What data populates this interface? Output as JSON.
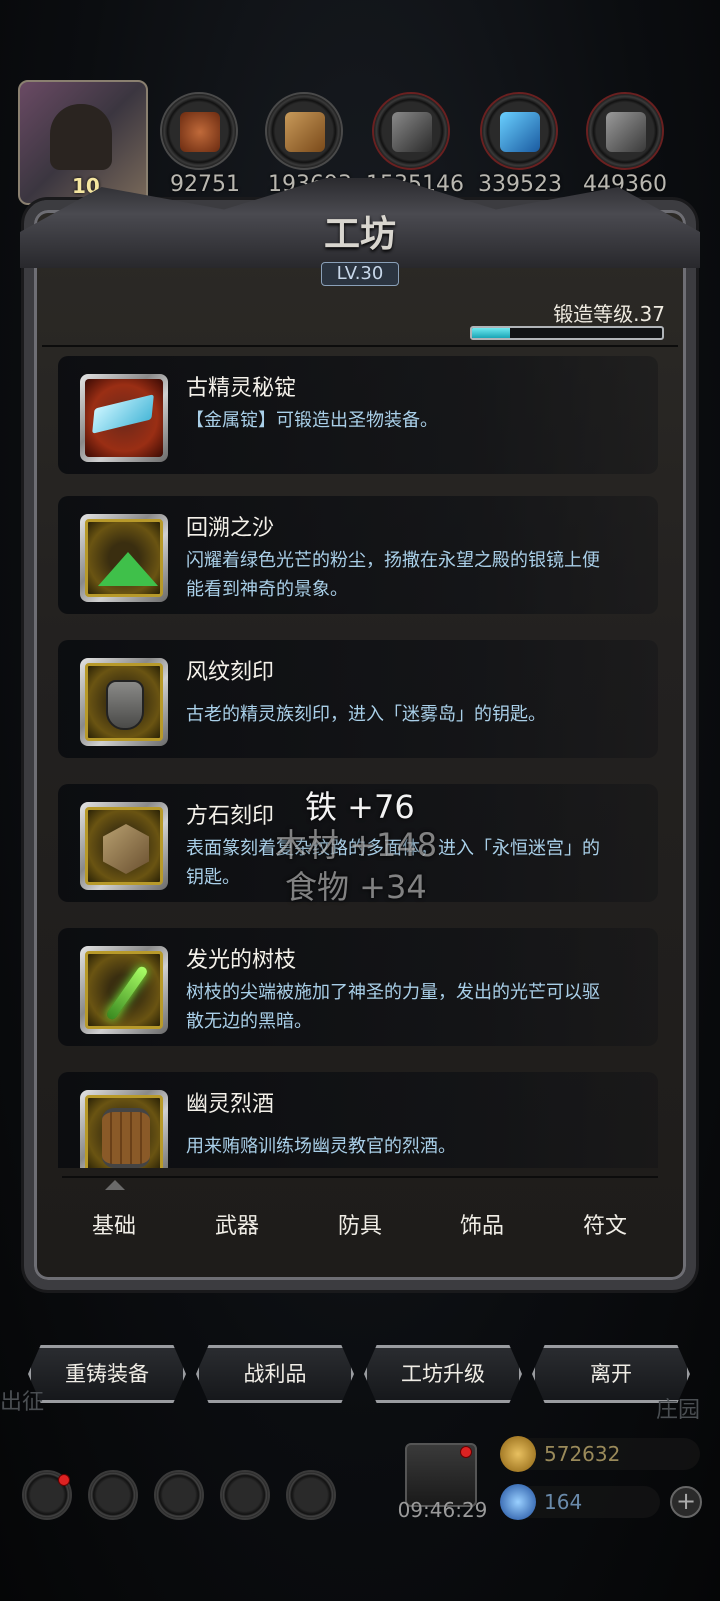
{
  "resources": [
    "92751",
    "193693",
    "1535146",
    "339523",
    "449360"
  ],
  "player": {
    "level": "10"
  },
  "workshop": {
    "title": "工坊",
    "level": "LV.30",
    "forge_label": "锻造等级.37",
    "forge_progress_percent": 20
  },
  "items": [
    {
      "name": "古精灵秘锭",
      "desc": "【金属锭】可锻造出圣物装备。",
      "icon": "ingot-icon"
    },
    {
      "name": "回溯之沙",
      "desc": "闪耀着绿色光芒的粉尘，扬撒在永望之殿的银镜上便能看到神奇的景象。",
      "icon": "sand-icon"
    },
    {
      "name": "风纹刻印",
      "desc": "古老的精灵族刻印，进入「迷雾岛」的钥匙。",
      "icon": "armor-seal-icon"
    },
    {
      "name": "方石刻印",
      "desc": "表面篆刻着复杂纹路的多面体，进入「永恒迷宫」的钥匙。",
      "icon": "cube-seal-icon"
    },
    {
      "name": "发光的树枝",
      "desc": "树枝的尖端被施加了神圣的力量，发出的光芒可以驱散无边的黑暗。",
      "icon": "branch-icon"
    },
    {
      "name": "幽灵烈酒",
      "desc": "用来贿赂训练场幽灵教官的烈酒。",
      "icon": "barrel-icon"
    }
  ],
  "gains": {
    "iron": "铁 +76",
    "wood": "木材 +148",
    "food": "食物 +34"
  },
  "tabs": [
    "基础",
    "武器",
    "防具",
    "饰品",
    "符文"
  ],
  "buttons": [
    "重铸装备",
    "战利品",
    "工坊升级",
    "离开"
  ],
  "hud": {
    "timer": "09:46:29",
    "gold": "572632",
    "gems": "164",
    "left_text": "出征",
    "right_text": "庄园"
  }
}
